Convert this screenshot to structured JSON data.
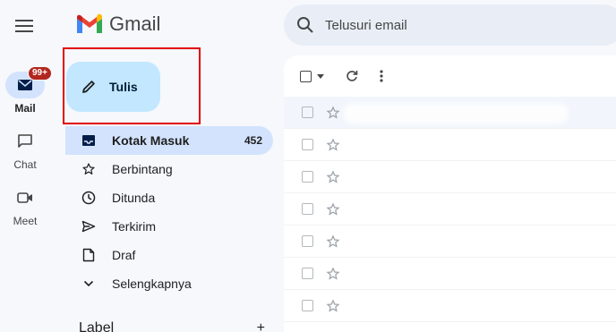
{
  "rail": {
    "items": [
      {
        "label": "Mail",
        "badge": "99+",
        "icon": "mail-icon"
      },
      {
        "label": "Chat",
        "icon": "chat-icon"
      },
      {
        "label": "Meet",
        "icon": "video-icon"
      }
    ]
  },
  "app": {
    "name": "Gmail"
  },
  "compose": {
    "label": "Tulis"
  },
  "nav": [
    {
      "label": "Kotak Masuk",
      "count": "452",
      "icon": "inbox-icon"
    },
    {
      "label": "Berbintang",
      "icon": "star-icon"
    },
    {
      "label": "Ditunda",
      "icon": "clock-icon"
    },
    {
      "label": "Terkirim",
      "icon": "send-icon"
    },
    {
      "label": "Draf",
      "icon": "draft-icon"
    },
    {
      "label": "Selengkapnya",
      "icon": "chevron-down-icon"
    }
  ],
  "labels": {
    "heading": "Label",
    "add": "+"
  },
  "search": {
    "placeholder": "Telusuri email"
  },
  "colors": {
    "accent": "#c2e7ff",
    "active_nav": "#d3e3fd",
    "highlight_box": "#e00000",
    "badge": "#b3261e"
  }
}
